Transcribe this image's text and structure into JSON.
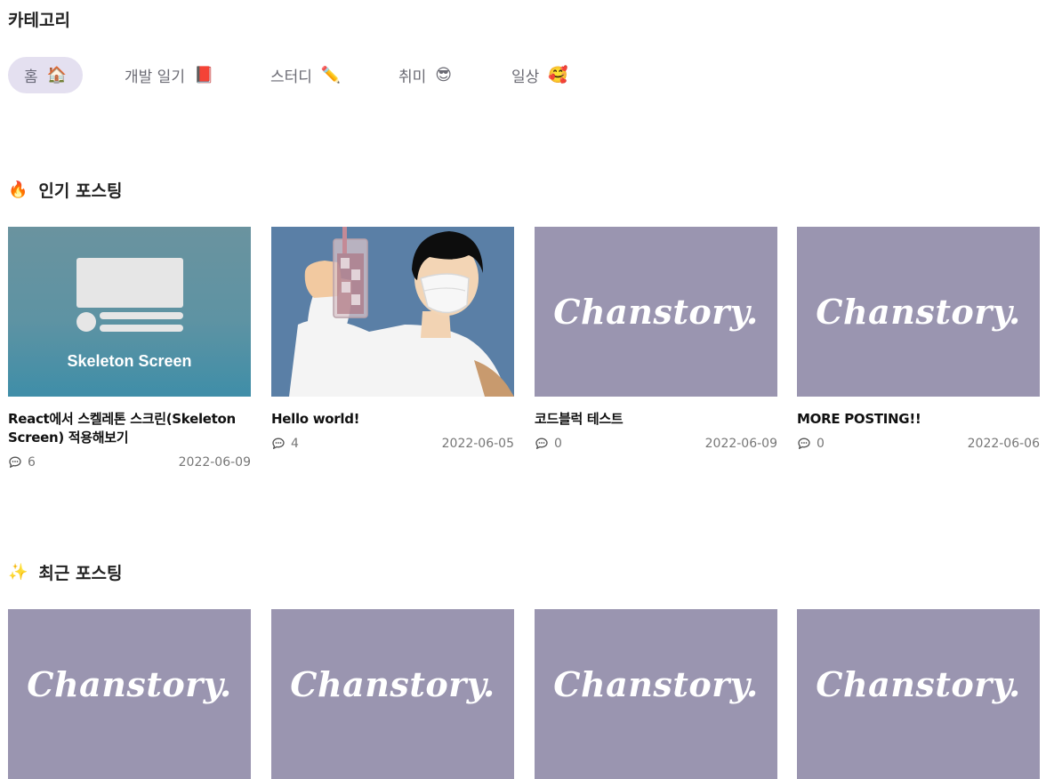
{
  "category": {
    "title": "카테고리",
    "tabs": [
      {
        "label": "홈",
        "emoji": "🏠",
        "active": true
      },
      {
        "label": "개발 일기",
        "emoji": "📕",
        "active": false
      },
      {
        "label": "스터디",
        "emoji": "✏️",
        "active": false
      },
      {
        "label": "취미",
        "emoji": "😎",
        "active": false
      },
      {
        "label": "일상",
        "emoji": "🥰",
        "active": false
      }
    ]
  },
  "popular": {
    "icon": "🔥",
    "title": "인기 포스팅",
    "posts": [
      {
        "thumb_text": "Skeleton Screen",
        "title": "React에서 스켈레톤 스크린(Skeleton Screen) 적용해보기",
        "comments": "6",
        "date": "2022-06-09"
      },
      {
        "title": "Hello world!",
        "comments": "4",
        "date": "2022-06-05"
      },
      {
        "thumb_text": "Chanstory.",
        "title": "코드블럭 테스트",
        "comments": "0",
        "date": "2022-06-09"
      },
      {
        "thumb_text": "Chanstory.",
        "title": "MORE POSTING!!",
        "comments": "0",
        "date": "2022-06-06"
      }
    ]
  },
  "recent": {
    "icon": "✨",
    "title": "최근 포스팅",
    "posts": [
      {
        "thumb_text": "Chanstory."
      },
      {
        "thumb_text": "Chanstory."
      },
      {
        "thumb_text": "Chanstory."
      },
      {
        "thumb_text": "Chanstory."
      }
    ]
  },
  "colors": {
    "active_tab_bg": "#e4e0f0",
    "brand_thumb": "#9a95b0",
    "skeleton_thumb_top": "#6a939f",
    "skeleton_thumb_bottom": "#3f8ea8",
    "illustration_bg": "#5a7fa6"
  }
}
